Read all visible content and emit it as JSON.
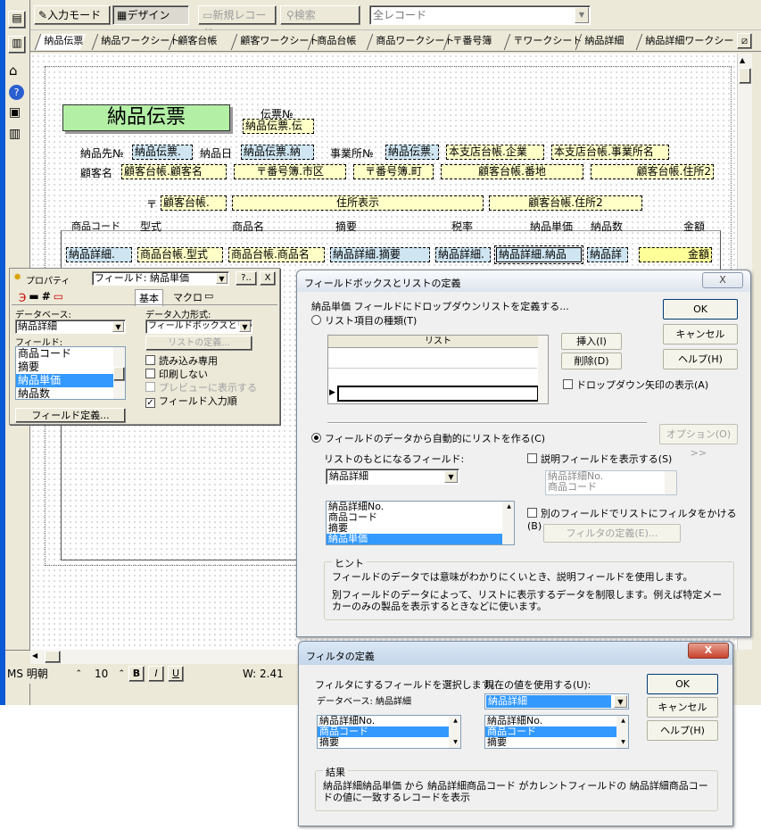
{
  "toolbar": {
    "input_mode": "入力モード",
    "design": "デザイン",
    "new_record": "新規レコード",
    "search": "検索",
    "record_filter": "全レコード"
  },
  "layout_tabs": [
    "納品伝票",
    "納品ワークシート",
    "顧客台帳",
    "顧客ワークシート",
    "商品台帳",
    "商品ワークシート",
    "〒番号簿",
    "〒ワークシート",
    "納品詳細",
    "納品詳細ワークシート"
  ],
  "form": {
    "title": "納品伝票",
    "slip_no_label": "伝票№",
    "slip_no_field": "納品伝票.伝",
    "dest_label": "納品先№",
    "dest_field": "納品伝票.",
    "date_label": "納品日",
    "date_field": "納品伝票.納",
    "office_label": "事業所№",
    "office_field": "納品伝票.",
    "office_company": "本支店台帳.企業",
    "office_name": "本支店台帳.事業所名",
    "customer_label": "顧客名",
    "customer_field": "顧客台帳.顧客名",
    "city_field": "〒番号簿.市区",
    "town_field": "〒番号簿.町",
    "banchi_field": "顧客台帳.番地",
    "address2_field": "顧客台帳.住所2",
    "postal_mark": "〒",
    "postal_field": "顧客台帳.",
    "address_display": "住所表示",
    "address2b_field": "顧客台帳.住所2",
    "columns": [
      "商品コード",
      "型式",
      "商品名",
      "摘要",
      "税率",
      "納品単価",
      "納品数",
      "金額"
    ],
    "row": [
      "納品詳細.",
      "商品台帳.型式",
      "商品台帳.商品名",
      "納品詳細.摘要",
      "納品詳細.",
      "納品詳細.納品",
      "納品詳",
      "金額"
    ]
  },
  "status": {
    "font": "MS 明朝",
    "size": "10",
    "bold": "B",
    "italic": "I",
    "underline": "U",
    "width": "W: 2.41"
  },
  "properties": {
    "title": "プロパティ",
    "object": "フィールド: 納品単価",
    "help_btn": "?..",
    "close_btn": "X",
    "tabs": [
      "基本",
      "マクロ"
    ],
    "db_label": "データベース:",
    "db_value": "納品詳細",
    "field_label": "フィールド:",
    "fields": [
      "商品コード",
      "摘要",
      "納品単価",
      "納品数"
    ],
    "selected_field": "納品単価",
    "field_def_btn": "フィールド定義...",
    "input_format_label": "データ入力形式:",
    "input_format_value": "フィールドボックスとリスト",
    "list_def_btn": "リストの定義...",
    "read_only": "読み込み専用",
    "no_print": "印刷しない",
    "preview_show": "プレビューに表示する",
    "field_input_order": "フィールド入力順"
  },
  "list_dialog": {
    "title": "フィールドボックスとリストの定義",
    "close_btn": "X",
    "description": "納品単価 フィールドにドロップダウンリストを定義する...",
    "radio_list_items": "リスト項目の種類(T)",
    "list_col_header": "リスト",
    "insert_btn": "挿入(I)",
    "delete_btn": "削除(D)",
    "show_arrow": "ドロップダウン矢印の表示(A)",
    "ok": "OK",
    "cancel": "キャンセル",
    "help": "ヘルプ(H)",
    "radio_auto": "フィールドのデータから自動的にリストを作る(C)",
    "options_btn": "オプション(O) >>",
    "source_field_label": "リストのもとになるフィールド:",
    "source_db": "納品詳細",
    "source_fields": [
      "納品詳細No.",
      "商品コード",
      "摘要",
      "納品単価"
    ],
    "source_selected": "納品単価",
    "show_desc_field": "説明フィールドを表示する(S)",
    "desc_fields": [
      "納品詳細No.",
      "商品コード"
    ],
    "filter_by_other": "別のフィールドでリストにフィルタをかける(B)",
    "filter_def_btn": "フィルタの定義(E)...",
    "hint_label": "ヒント",
    "hint1": "フィールドのデータでは意味がわかりにくいとき、説明フィールドを使用します。",
    "hint2": "別フィールドのデータによって、リストに表示するデータを制限します。例えば特定メーカーのみの製品を表示するときなどに使います。"
  },
  "filter_dialog": {
    "title": "フィルタの定義",
    "close_btn": "X",
    "select_label": "フィルタにするフィールドを選択します。",
    "db_label": "データベース: 納品詳細",
    "current_value_label": "現在の値を使用する(U):",
    "current_value_db": "納品詳細",
    "left_list": [
      "納品詳細No.",
      "商品コード",
      "摘要"
    ],
    "right_list": [
      "納品詳細No.",
      "商品コード",
      "摘要"
    ],
    "selected": "商品コード",
    "ok": "OK",
    "cancel": "キャンセル",
    "help": "ヘルプ(H)",
    "result_label": "結果",
    "result_text": "納品詳細納品単価 から 納品詳細商品コード がカレントフィールドの 納品詳細商品コードの値に一致するレコードを表示"
  }
}
